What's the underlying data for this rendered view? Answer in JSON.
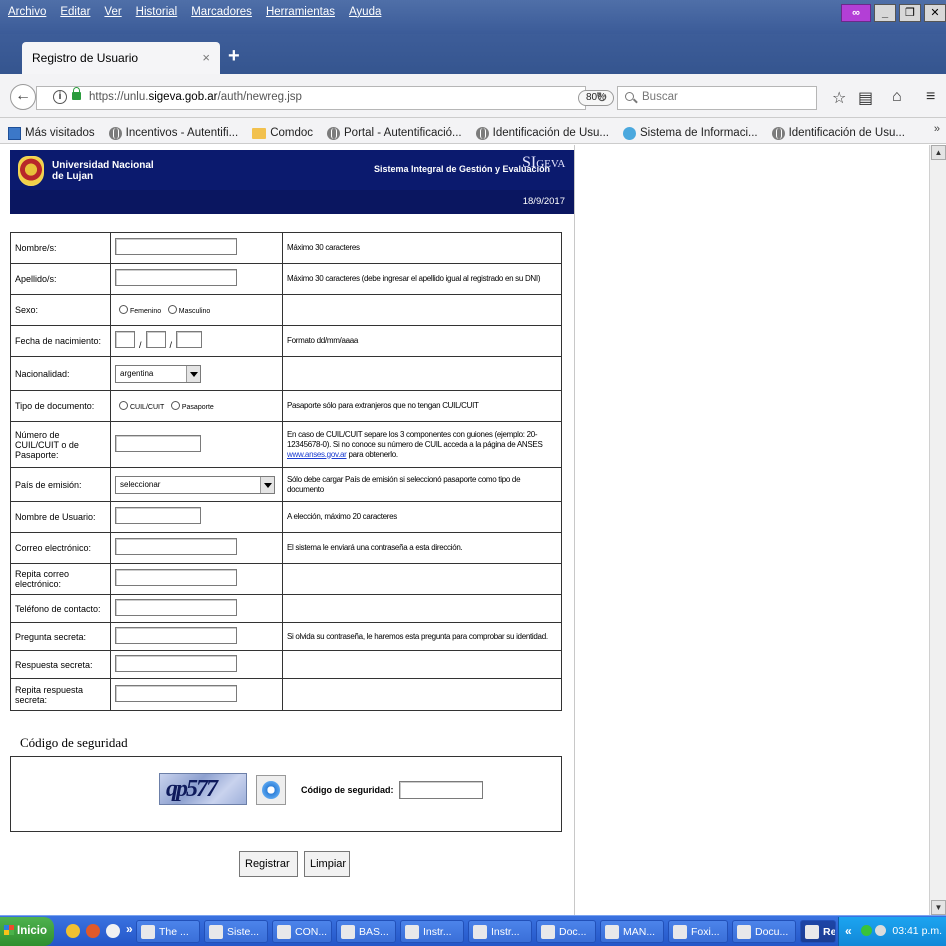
{
  "browser": {
    "menu": [
      "Archivo",
      "Editar",
      "Ver",
      "Historial",
      "Marcadores",
      "Herramientas",
      "Ayuda"
    ],
    "tab_title": "Registro de Usuario",
    "tab_close": "×",
    "new_tab": "+",
    "url_prefix": "https://unlu.",
    "url_domain": "sigeva.gob.ar",
    "url_path": "/auth/newreg.jsp",
    "zoom": "80%",
    "search_placeholder": "Buscar",
    "bookmarks": [
      "Más visitados",
      "Incentivos - Autentifi...",
      "Comdoc",
      "Portal - Autentificació...",
      "Identificación de Usu...",
      "Sistema de Informaci...",
      "Identificación de Usu..."
    ],
    "bookmarks_more": "»"
  },
  "header": {
    "university_line1": "Universidad Nacional",
    "university_line2": "de Lujan",
    "system_name": "Sistema Integral de Gestión y Evaluación",
    "logo_si": "SI",
    "logo_geva": "GEVA",
    "date": "18/9/2017"
  },
  "form": {
    "nombre_label": "Nombre/s:",
    "nombre_hint": "Máximo 30 caracteres",
    "apellido_label": "Apellido/s:",
    "apellido_hint": "Máximo 30 caracteres (debe ingresar el apellido igual al registrado en su DNI)",
    "sexo_label": "Sexo:",
    "sexo_options": [
      "Femenino",
      "Masculino"
    ],
    "fecha_label": "Fecha de nacimiento:",
    "fecha_sep": "/",
    "fecha_hint": "Formato dd/mm/aaaa",
    "nacionalidad_label": "Nacionalidad:",
    "nacionalidad_value": "argentina",
    "tipo_doc_label": "Tipo de documento:",
    "tipo_doc_options": [
      "CUIL/CUIT",
      "Pasaporte"
    ],
    "tipo_doc_hint": "Pasaporte sólo para extranjeros que no tengan CUIL/CUIT",
    "numero_label": "Número de CUIL/CUIT o de Pasaporte:",
    "numero_hint_1": "En caso de CUIL/CUIT separe los 3 componentes con guiones (ejemplo: 20-12345678-0). Si no conoce su número de CUIL acceda a la página de ANSES",
    "numero_hint_link": "www.anses.gov.ar",
    "numero_hint_2": "para obtenerlo.",
    "pais_label": "País de emisión:",
    "pais_value": "seleccionar",
    "pais_hint": "Sólo debe cargar País de emisión si seleccionó pasaporte como tipo de documento",
    "usuario_label": "Nombre de Usuario:",
    "usuario_hint": "A elección, máximo 20 caracteres",
    "correo_label": "Correo electrónico:",
    "correo_hint": "El sistema le enviará una contraseña a esta dirección.",
    "repita_correo_label": "Repita correo electrónico:",
    "telefono_label": "Teléfono de contacto:",
    "pregunta_label": "Pregunta secreta:",
    "pregunta_hint": "Si olvida su contraseña, le haremos esta pregunta para comprobar su identidad.",
    "respuesta_label": "Respuesta secreta:",
    "repita_respuesta_label": "Repita respuesta secreta:",
    "security_heading": "Código de seguridad",
    "captcha_text": "qp577",
    "security_code_label": "Código de seguridad:",
    "register_button": "Registrar",
    "clear_button": "Limpiar"
  },
  "taskbar": {
    "start": "Inicio",
    "more": "»",
    "items": [
      "The ...",
      "Siste...",
      "CON...",
      "BAS...",
      "Instr...",
      "Instr...",
      "Doc...",
      "MAN...",
      "Foxi...",
      "Docu...",
      "Regi..."
    ],
    "tray_more": "«",
    "time": "03:41 p.m."
  }
}
